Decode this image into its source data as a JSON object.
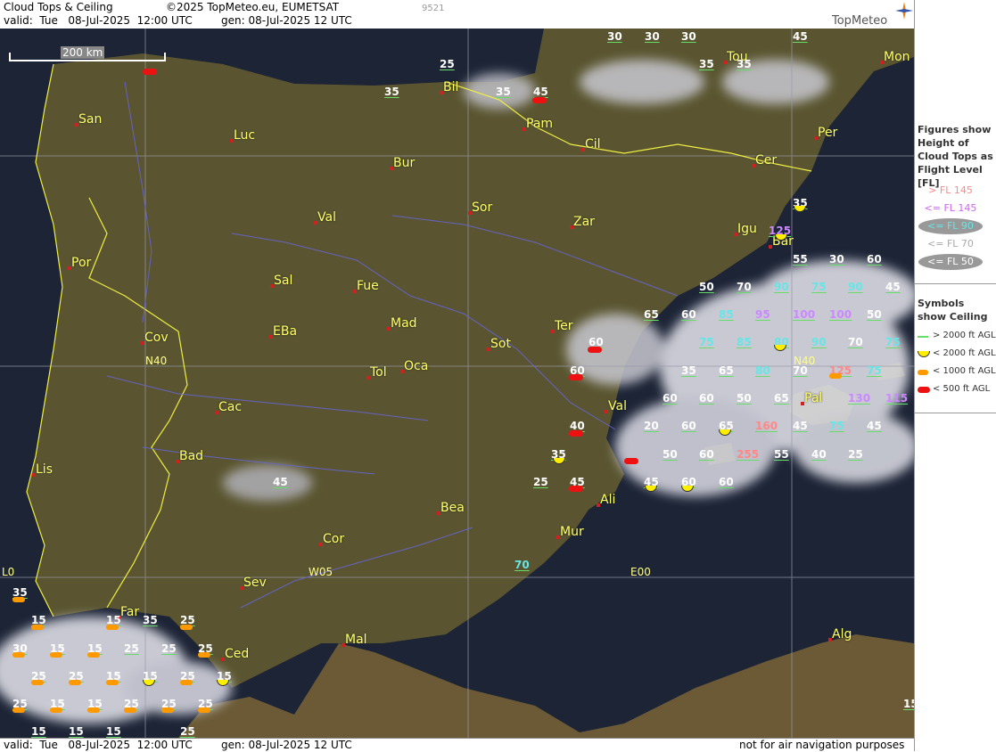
{
  "header": {
    "title": "Cloud Tops & Ceiling",
    "copyright": "©2025 TopMeteo.eu, EUMETSAT",
    "valid": "valid:  Tue   08-Jul-2025  12:00 UTC",
    "generated": "gen: 08-Jul-2025 12 UTC",
    "image_id": "9521",
    "brand": "TopMeteo"
  },
  "footer": {
    "valid": "valid:  Tue   08-Jul-2025  12:00 UTC",
    "generated": "gen: 08-Jul-2025 12 UTC",
    "disclaimer": "not for air navigation purposes"
  },
  "scale": {
    "label": "200 km"
  },
  "grid_labels": [
    {
      "id": "n40-west",
      "text": "N40"
    },
    {
      "id": "n40-east",
      "text": "N40"
    },
    {
      "id": "w05",
      "text": "W05"
    },
    {
      "id": "e00",
      "text": "E00"
    },
    {
      "id": "l0",
      "text": "L0"
    }
  ],
  "cities": [
    {
      "name": "San"
    },
    {
      "name": "Luc"
    },
    {
      "name": "Bil"
    },
    {
      "name": "Pam"
    },
    {
      "name": "Tou"
    },
    {
      "name": "Mon"
    },
    {
      "name": "Bur"
    },
    {
      "name": "Cil"
    },
    {
      "name": "Per"
    },
    {
      "name": "Cer"
    },
    {
      "name": "Val"
    },
    {
      "name": "Sor"
    },
    {
      "name": "Zar"
    },
    {
      "name": "Igu"
    },
    {
      "name": "Bar"
    },
    {
      "name": "Por"
    },
    {
      "name": "Sal"
    },
    {
      "name": "Fue"
    },
    {
      "name": "Mad"
    },
    {
      "name": "Cov"
    },
    {
      "name": "EBa"
    },
    {
      "name": "Sot"
    },
    {
      "name": "Ter"
    },
    {
      "name": "Tol"
    },
    {
      "name": "Oca"
    },
    {
      "name": "Cac"
    },
    {
      "name": "Val"
    },
    {
      "name": "Pal"
    },
    {
      "name": "Lis"
    },
    {
      "name": "Bad"
    },
    {
      "name": "Ali"
    },
    {
      "name": "Bea"
    },
    {
      "name": "Mur"
    },
    {
      "name": "Cor"
    },
    {
      "name": "Sev"
    },
    {
      "name": "Far"
    },
    {
      "name": "Ced"
    },
    {
      "name": "Mal"
    },
    {
      "name": "Alg"
    }
  ],
  "values": [
    {
      "v": "30",
      "c": "#ffffff"
    },
    {
      "v": "30",
      "c": "#ffffff"
    },
    {
      "v": "30",
      "c": "#ffffff"
    },
    {
      "v": "45",
      "c": "#ffffff"
    },
    {
      "v": "25",
      "c": "#ffffff"
    },
    {
      "v": "35",
      "c": "#ffffff"
    },
    {
      "v": "35",
      "c": "#ffffff"
    },
    {
      "v": "35",
      "c": "#ffffff"
    },
    {
      "v": "35",
      "c": "#ffffff"
    },
    {
      "v": "45",
      "c": "#ffffff"
    },
    {
      "v": "35",
      "c": "#ffffff"
    },
    {
      "v": "125",
      "c": "#cc88ff"
    },
    {
      "v": "55",
      "c": "#ffffff"
    },
    {
      "v": "30",
      "c": "#ffffff"
    },
    {
      "v": "60",
      "c": "#ffffff"
    },
    {
      "v": "50",
      "c": "#ffffff"
    },
    {
      "v": "70",
      "c": "#ffffff"
    },
    {
      "v": "90",
      "c": "#66e6e6"
    },
    {
      "v": "75",
      "c": "#66e6e6"
    },
    {
      "v": "90",
      "c": "#66e6e6"
    },
    {
      "v": "45",
      "c": "#ffffff"
    },
    {
      "v": "65",
      "c": "#ffffff"
    },
    {
      "v": "60",
      "c": "#ffffff"
    },
    {
      "v": "85",
      "c": "#66e6e6"
    },
    {
      "v": "95",
      "c": "#cc88ff"
    },
    {
      "v": "100",
      "c": "#cc88ff"
    },
    {
      "v": "100",
      "c": "#cc88ff"
    },
    {
      "v": "50",
      "c": "#ffffff"
    },
    {
      "v": "60",
      "c": "#ffffff"
    },
    {
      "v": "75",
      "c": "#66e6e6"
    },
    {
      "v": "85",
      "c": "#66e6e6"
    },
    {
      "v": "80",
      "c": "#66e6e6"
    },
    {
      "v": "90",
      "c": "#66e6e6"
    },
    {
      "v": "70",
      "c": "#ffffff"
    },
    {
      "v": "75",
      "c": "#66e6e6"
    },
    {
      "v": "60",
      "c": "#ffffff"
    },
    {
      "v": "35",
      "c": "#ffffff"
    },
    {
      "v": "65",
      "c": "#ffffff"
    },
    {
      "v": "80",
      "c": "#66e6e6"
    },
    {
      "v": "70",
      "c": "#ffffff"
    },
    {
      "v": "125",
      "c": "#ff8888"
    },
    {
      "v": "75",
      "c": "#66e6e6"
    },
    {
      "v": "60",
      "c": "#ffffff"
    },
    {
      "v": "60",
      "c": "#ffffff"
    },
    {
      "v": "50",
      "c": "#ffffff"
    },
    {
      "v": "65",
      "c": "#ffffff"
    },
    {
      "v": "130",
      "c": "#cc88ff"
    },
    {
      "v": "115",
      "c": "#cc88ff"
    },
    {
      "v": "40",
      "c": "#ffffff"
    },
    {
      "v": "20",
      "c": "#ffffff"
    },
    {
      "v": "60",
      "c": "#ffffff"
    },
    {
      "v": "65",
      "c": "#ffffff"
    },
    {
      "v": "160",
      "c": "#ff8888"
    },
    {
      "v": "45",
      "c": "#ffffff"
    },
    {
      "v": "75",
      "c": "#66e6e6"
    },
    {
      "v": "45",
      "c": "#ffffff"
    },
    {
      "v": "35",
      "c": "#ffffff"
    },
    {
      "v": "50",
      "c": "#ffffff"
    },
    {
      "v": "60",
      "c": "#ffffff"
    },
    {
      "v": "255",
      "c": "#ff8888"
    },
    {
      "v": "55",
      "c": "#ffffff"
    },
    {
      "v": "40",
      "c": "#ffffff"
    },
    {
      "v": "25",
      "c": "#ffffff"
    },
    {
      "v": "25",
      "c": "#ffffff"
    },
    {
      "v": "45",
      "c": "#ffffff"
    },
    {
      "v": "45",
      "c": "#ffffff"
    },
    {
      "v": "60",
      "c": "#ffffff"
    },
    {
      "v": "60",
      "c": "#ffffff"
    },
    {
      "v": "45",
      "c": "#ffffff"
    },
    {
      "v": "70",
      "c": "#66e6e6"
    },
    {
      "v": "35",
      "c": "#ffffff"
    },
    {
      "v": "15",
      "c": "#ffffff"
    },
    {
      "v": "15",
      "c": "#ffffff"
    },
    {
      "v": "35",
      "c": "#ffffff"
    },
    {
      "v": "25",
      "c": "#ffffff"
    },
    {
      "v": "30",
      "c": "#ffffff"
    },
    {
      "v": "15",
      "c": "#ffffff"
    },
    {
      "v": "15",
      "c": "#ffffff"
    },
    {
      "v": "25",
      "c": "#ffffff"
    },
    {
      "v": "25",
      "c": "#ffffff"
    },
    {
      "v": "25",
      "c": "#ffffff"
    },
    {
      "v": "25",
      "c": "#ffffff"
    },
    {
      "v": "25",
      "c": "#ffffff"
    },
    {
      "v": "15",
      "c": "#ffffff"
    },
    {
      "v": "15",
      "c": "#ffffff"
    },
    {
      "v": "25",
      "c": "#ffffff"
    },
    {
      "v": "15",
      "c": "#ffffff"
    },
    {
      "v": "25",
      "c": "#ffffff"
    },
    {
      "v": "15",
      "c": "#ffffff"
    },
    {
      "v": "15",
      "c": "#ffffff"
    },
    {
      "v": "25",
      "c": "#ffffff"
    },
    {
      "v": "25",
      "c": "#ffffff"
    },
    {
      "v": "25",
      "c": "#ffffff"
    },
    {
      "v": "15",
      "c": "#ffffff"
    },
    {
      "v": "15",
      "c": "#ffffff"
    },
    {
      "v": "15",
      "c": "#ffffff"
    },
    {
      "v": "25",
      "c": "#ffffff"
    },
    {
      "v": "15",
      "c": "#ffffff"
    },
    {
      "v": "50",
      "c": "#ffffff"
    }
  ],
  "legend": {
    "figures_title": "Figures show Height of Cloud Tops as Flight Level  [FL]",
    "fl_items": [
      {
        "label": "> FL 145",
        "c": "#ff8888"
      },
      {
        "label": "<= FL 145",
        "c": "#cc66ee"
      },
      {
        "label": "<= FL 90",
        "c": "#66e6e6"
      },
      {
        "label": "<= FL 70",
        "c": "#aaaaaa"
      },
      {
        "label": "<= FL 50",
        "c": "#ffffff"
      }
    ],
    "symbols_title": "Symbols show Ceiling",
    "sym_items": [
      {
        "label": "> 2000 ft AGL",
        "kind": "green"
      },
      {
        "label": "< 2000 ft AGL",
        "kind": "yellow"
      },
      {
        "label": "< 1000 ft AGL",
        "kind": "orange"
      },
      {
        "label": "< 500 ft AGL",
        "kind": "red"
      }
    ]
  },
  "colors": {
    "city": "#ffff66",
    "land": "#5a5a30",
    "sea": "#1a2233",
    "cloud": "#e8e8ee"
  }
}
